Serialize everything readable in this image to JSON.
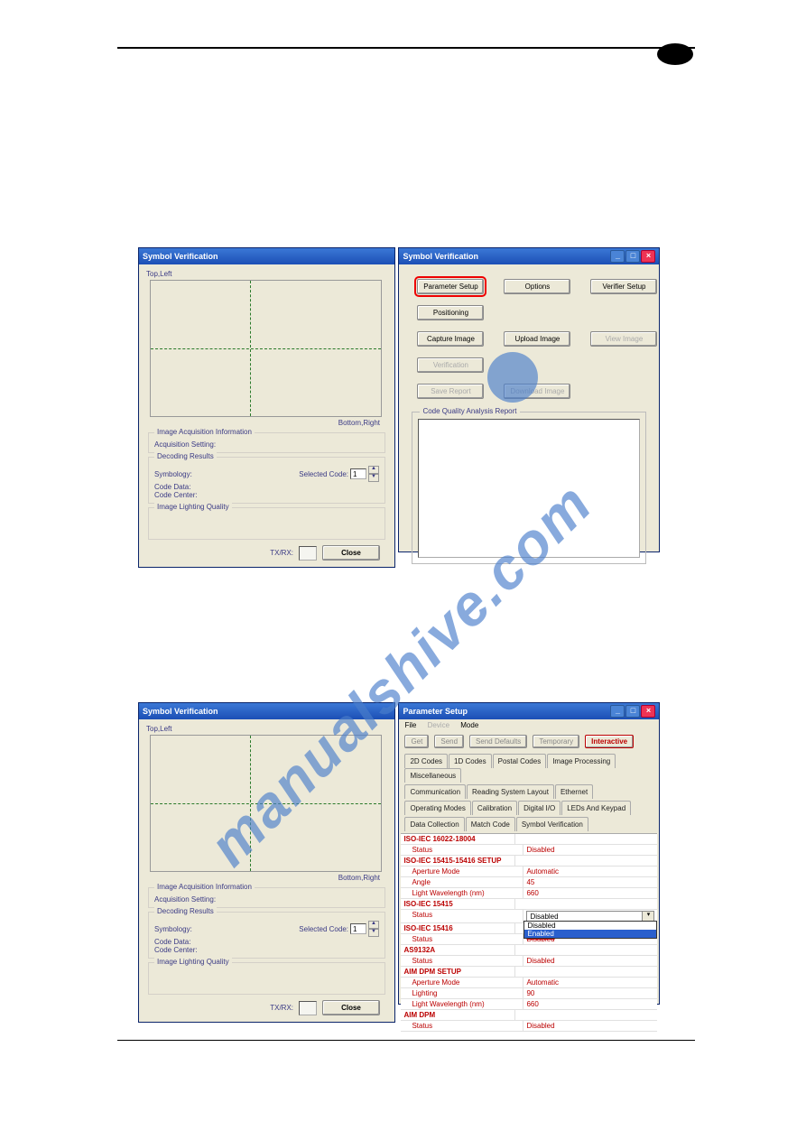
{
  "watermark_text": "manualshive.com",
  "windows": {
    "sv_title": "Symbol Verification",
    "ps_title": "Parameter Setup",
    "labels": {
      "top_left": "Top,Left",
      "bottom_right": "Bottom,Right",
      "image_acq_info": "Image Acquisition Information",
      "acq_setting": "Acquisition Setting:",
      "decoding_results": "Decoding Results",
      "symbology": "Symbology:",
      "selected_code": "Selected Code:",
      "code_data": "Code Data:",
      "code_center": "Code Center:",
      "image_lighting_quality": "Image Lighting Quality",
      "txrx": "TX/RX:",
      "close": "Close",
      "report_title": "Code Quality Analysis Report",
      "spin_value": "1"
    },
    "right_buttons": {
      "parameter_setup": "Parameter Setup",
      "options": "Options",
      "verifier_setup": "Verifier Setup",
      "positioning": "Positioning",
      "capture_image": "Capture Image",
      "upload_image": "Upload Image",
      "view_image": "View Image",
      "verification": "Verification",
      "save_report": "Save Report",
      "download_image": "Download Image"
    }
  },
  "psetup": {
    "menu": {
      "file": "File",
      "device": "Device",
      "mode": "Mode"
    },
    "top_buttons": {
      "get": "Get",
      "send": "Send",
      "send_defaults": "Send Defaults",
      "temporary": "Temporary",
      "interactive": "Interactive"
    },
    "tabs_row1": [
      "2D Codes",
      "1D Codes",
      "Postal Codes",
      "Image Processing",
      "Miscellaneous"
    ],
    "tabs_row2": [
      "Communication",
      "Reading System Layout",
      "Ethernet"
    ],
    "tabs_row3": [
      "Operating Modes",
      "Calibration",
      "Digital I/O",
      "LEDs And Keypad"
    ],
    "tabs_row4": [
      "Data Collection",
      "Match Code",
      "Symbol Verification"
    ],
    "rows": [
      {
        "type": "group",
        "label": "ISO-IEC 16022-18004"
      },
      {
        "type": "param",
        "label": "Status",
        "value": "Disabled"
      },
      {
        "type": "group",
        "label": "ISO-IEC 15415-15416 SETUP"
      },
      {
        "type": "param",
        "label": "Aperture Mode",
        "value": "Automatic"
      },
      {
        "type": "param",
        "label": "Angle",
        "value": "45"
      },
      {
        "type": "param",
        "label": "Light Wavelength (nm)",
        "value": "660"
      },
      {
        "type": "group",
        "label": "ISO-IEC 15415"
      },
      {
        "type": "dropdown",
        "label": "Status",
        "selected": "Disabled",
        "options": [
          "Disabled",
          "Enabled"
        ],
        "hl": 1
      },
      {
        "type": "group",
        "label": "ISO-IEC 15416"
      },
      {
        "type": "param",
        "label": "Status",
        "value": "Disabled",
        "overlay": true
      },
      {
        "type": "group",
        "label": "AS9132A"
      },
      {
        "type": "param",
        "label": "Status",
        "value": "Disabled"
      },
      {
        "type": "group",
        "label": "AIM DPM SETUP"
      },
      {
        "type": "param",
        "label": "Aperture Mode",
        "value": "Automatic"
      },
      {
        "type": "param",
        "label": "Lighting",
        "value": "90"
      },
      {
        "type": "param",
        "label": "Light Wavelength (nm)",
        "value": "660"
      },
      {
        "type": "group",
        "label": "AIM DPM"
      },
      {
        "type": "param",
        "label": "Status",
        "value": "Disabled"
      }
    ]
  }
}
